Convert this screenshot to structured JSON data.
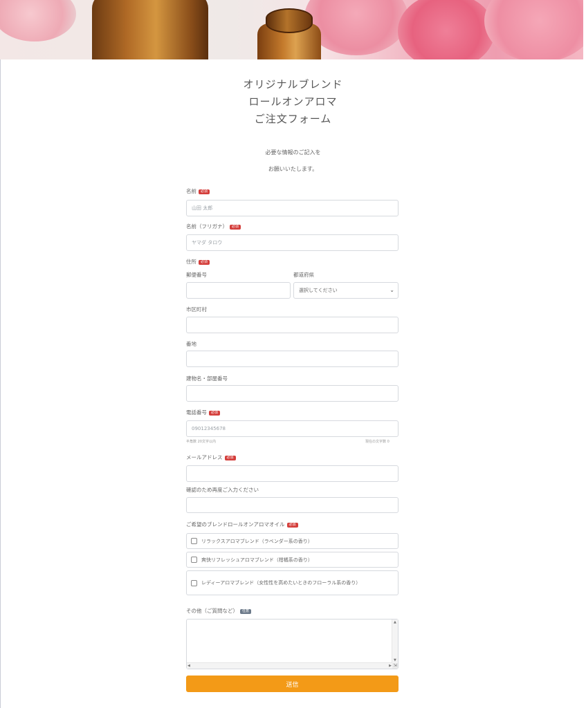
{
  "header": {
    "title_lines": [
      "オリジナルブレンド",
      "ロールオンアロマ",
      "ご注文フォーム"
    ],
    "intro_lines": [
      "必要な情報のご記入を",
      "お願いいたします。"
    ]
  },
  "badges": {
    "required": "必須",
    "optional": "任意"
  },
  "fields": {
    "name": {
      "label": "名前",
      "placeholder": "山田 太郎"
    },
    "kana": {
      "label": "名前（フリガナ）",
      "placeholder": "ヤマダ タロウ"
    },
    "address": {
      "label": "住所",
      "postal_label": "郵便番号",
      "prefecture_label": "都道府県",
      "prefecture_value": "選択してください",
      "city_label": "市区町村",
      "street_label": "番地",
      "building_label": "建物名・部屋番号"
    },
    "phone": {
      "label": "電話番号",
      "placeholder": "09012345678",
      "hint_left": "半角数 20文字以内",
      "hint_right": "現在の文字数 0"
    },
    "email": {
      "label": "メールアドレス"
    },
    "email_confirm": {
      "label": "確認のため再度ご入力ください"
    },
    "blend": {
      "label": "ご希望のブレンドロールオンアロマオイル",
      "options": [
        "リラックスアロマブレンド（ラベンダー系の香り）",
        "爽快リフレッシュアロマブレンド（柑橘系の香り）",
        "レディーアロマブレンド（女性性を高めたいときのフローラル系の香り）"
      ]
    },
    "other": {
      "label": "その他（ご質問など）"
    }
  },
  "submit_label": "送信",
  "colors": {
    "accent": "#f39a17",
    "required_badge": "#d43e3b",
    "optional_badge": "#6c7a8a"
  },
  "icons": {
    "select": "chevron-down-icon",
    "resize": "resize-grip-icon"
  }
}
